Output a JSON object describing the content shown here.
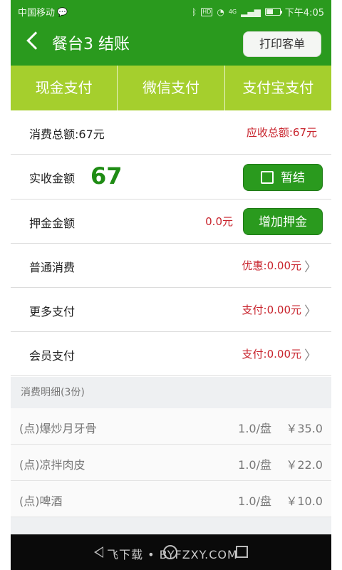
{
  "status": {
    "carrier": "中国移动",
    "time": "下午4:05",
    "hd": "HD",
    "network": "4G",
    "battery_level": 0.5
  },
  "header": {
    "title": "餐台3  结账",
    "print_label": "打印客单"
  },
  "tabs": [
    {
      "label": "现金支付"
    },
    {
      "label": "微信支付"
    },
    {
      "label": "支付宝支付"
    }
  ],
  "summary": {
    "total_label": "消费总额:67元",
    "receivable_label": "应收总额:67元"
  },
  "received": {
    "label": "实收金额",
    "value": "67",
    "hold_label": "暂结"
  },
  "deposit": {
    "label": "押金金额",
    "value": "0.0元",
    "add_label": "增加押金"
  },
  "rows": [
    {
      "label": "普通消费",
      "value": "优惠:0.00元"
    },
    {
      "label": "更多支付",
      "value": "支付:0.00元"
    },
    {
      "label": "会员支付",
      "value": "支付:0.00元"
    }
  ],
  "details": {
    "header": "消费明细(3份)",
    "items": [
      {
        "name": "(点)爆炒月牙骨",
        "qty": "1.0/盘",
        "price": "￥35.0"
      },
      {
        "name": "(点)凉拌肉皮",
        "qty": "1.0/盘",
        "price": "￥22.0"
      },
      {
        "name": "(点)啤酒",
        "qty": "1.0/盘",
        "price": "￥10.0"
      }
    ]
  },
  "watermark": "飞下载 • BYFZXY.COM",
  "colors": {
    "header_green": "#2a9a1e",
    "tab_green": "#a5cf2d",
    "amount_red": "#c8232c",
    "value_green": "#1f8c14"
  }
}
